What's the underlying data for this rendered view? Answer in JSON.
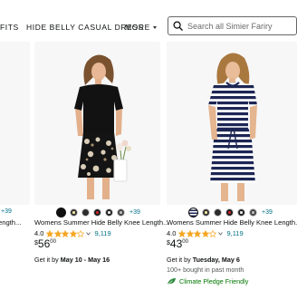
{
  "nav": {
    "items": [
      "FITS",
      "HIDE BELLY CASUAL DRESS"
    ],
    "more_label": "MORE",
    "search_placeholder": "Search all Simier Fariry"
  },
  "left_partial": {
    "more_colors": "+39",
    "title_fragment": "ength..."
  },
  "products": [
    {
      "more_colors": "+39",
      "title": "Womens Summer Hide Belly Knee Length...",
      "rating": "4.0",
      "stars": 4,
      "review_count": "9,119",
      "price_symbol": "$",
      "price_whole": "56",
      "price_fraction": "00",
      "delivery_prefix": "Get it by ",
      "delivery_date": "May 10 - May 16",
      "bought": "",
      "pledge": ""
    },
    {
      "more_colors": "+39",
      "title": "Womens Summer Hide Belly Knee Length...",
      "rating": "4.0",
      "stars": 4,
      "review_count": "9,119",
      "price_symbol": "$",
      "price_whole": "43",
      "price_fraction": "00",
      "delivery_prefix": "Get it by ",
      "delivery_date": "Tuesday, May 6",
      "bought": "100+ bought in past month",
      "pledge": "Climate Pledge Friendly"
    }
  ],
  "colors": {
    "link": "#007185",
    "star": "#f5a623",
    "pledge": "#007600",
    "dress_black": "#111111",
    "stripe_navy": "#1d2654"
  }
}
